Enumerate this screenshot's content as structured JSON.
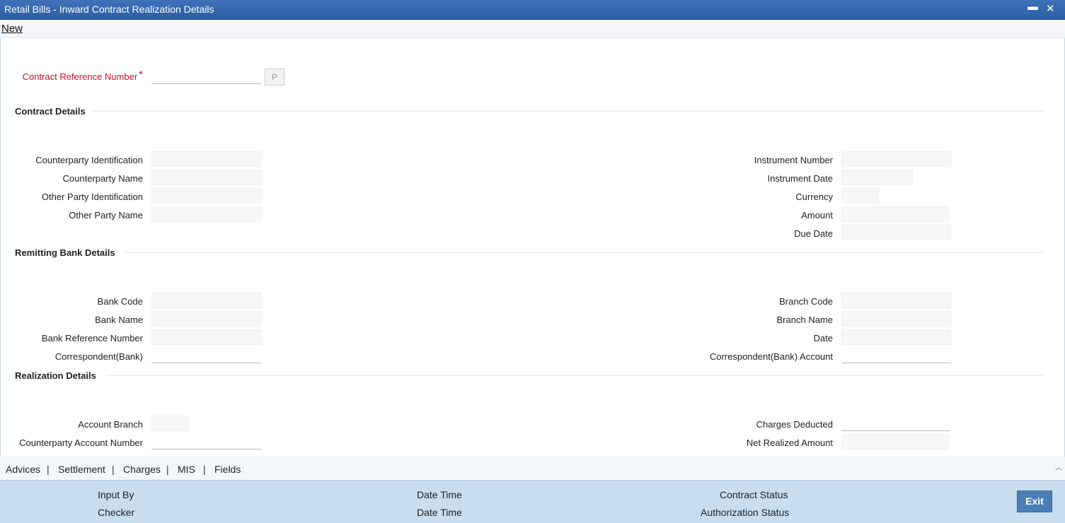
{
  "window": {
    "title": "Retail Bills - Inward Contract Realization Details"
  },
  "toolbar": {
    "new_label": "New"
  },
  "header": {
    "contract_ref_label": "Contract Reference Number",
    "required_marker": "*",
    "lookup_label": "P",
    "contract_ref_value": ""
  },
  "sections": {
    "contract": "Contract Details",
    "remitting": "Remitting Bank Details",
    "realization": "Realization Details"
  },
  "contract_details": {
    "counterparty_id": "Counterparty Identification",
    "counterparty_name": "Counterparty Name",
    "other_party_id": "Other Party Identification",
    "other_party_name": "Other Party Name",
    "instrument_number": "Instrument Number",
    "instrument_date": "Instrument Date",
    "currency": "Currency",
    "amount": "Amount",
    "due_date": "Due Date"
  },
  "remitting_bank": {
    "bank_code": "Bank Code",
    "bank_name": "Bank Name",
    "bank_ref": "Bank Reference Number",
    "correspondent": "Correspondent(Bank)",
    "branch_code": "Branch Code",
    "branch_name": "Branch Name",
    "date": "Date",
    "correspondent_account": "Correspondent(Bank) Account"
  },
  "realization": {
    "account_branch": "Account Branch",
    "counterparty_account": "Counterparty Account Number",
    "charges_deducted": "Charges Deducted",
    "net_realized": "Net Realized Amount"
  },
  "tabs": [
    "Advices",
    "Settlement",
    "Charges",
    "MIS",
    "Fields"
  ],
  "tab_separator": "|",
  "footer": {
    "input_by": "Input By",
    "checker": "Checker",
    "date_time": "Date Time",
    "contract_status": "Contract Status",
    "authorization_status": "Authorization Status",
    "exit": "Exit"
  },
  "colors": {
    "titlebar": "#2c5ea4",
    "required": "#c8102e",
    "footer": "#c8deef",
    "exit_button": "#4a7fb5"
  }
}
